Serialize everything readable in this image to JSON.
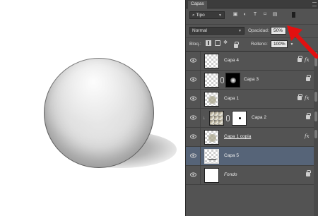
{
  "panel": {
    "tab": "Capas",
    "filter": {
      "label": "Tipo"
    },
    "blend_mode": "Normal",
    "opacity_label": "Opacidad:",
    "opacity_value": "50%",
    "lock_label": "Bloq.:",
    "fill_label": "Relleno:",
    "fill_value": "100%"
  },
  "layers": [
    {
      "name": "Capa 4",
      "fx": true,
      "lock": true,
      "selected": false
    },
    {
      "name": "Capa 3",
      "mask": true,
      "lock": true,
      "selected": false
    },
    {
      "name": "Capa 1",
      "fx": true,
      "lock": true,
      "selected": false
    },
    {
      "name": "Capa 2",
      "clipped": true,
      "mask": true,
      "lock": true,
      "selected": false
    },
    {
      "name": "Capa 1 copia",
      "fx": true,
      "selected": false
    },
    {
      "name": "Capa 5",
      "lock": true,
      "selected": true
    },
    {
      "name": "Fondo",
      "lock": true,
      "selected": false
    }
  ],
  "colors": {
    "panel_bg": "#535353",
    "selected_row": "#566478",
    "annotation_arrow": "#e31010"
  },
  "icons": [
    "eye-icon",
    "lock-icon",
    "fx-icon",
    "chain-icon",
    "arrow-annotation"
  ]
}
